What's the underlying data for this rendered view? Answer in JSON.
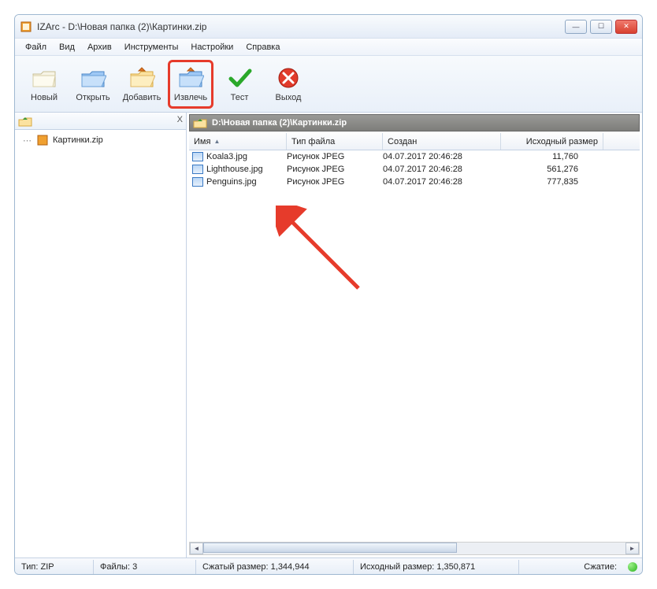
{
  "window_title": "IZArc - D:\\Новая папка (2)\\Картинки.zip",
  "menu": {
    "file": "Файл",
    "view": "Вид",
    "archive": "Архив",
    "tools": "Инструменты",
    "settings": "Настройки",
    "help": "Справка"
  },
  "toolbar": {
    "new": "Новый",
    "open": "Открыть",
    "add": "Добавить",
    "extract": "Извлечь",
    "test": "Тест",
    "exit": "Выход"
  },
  "tree": {
    "root": "Картинки.zip"
  },
  "path_display": "D:\\Новая папка (2)\\Картинки.zip",
  "columns": {
    "name": "Имя",
    "type": "Тип файла",
    "created": "Создан",
    "orig_size": "Исходный размер"
  },
  "files": [
    {
      "name": "Koala3.jpg",
      "type": "Рисунок JPEG",
      "date": "04.07.2017 20:46:28",
      "size": "11,760"
    },
    {
      "name": "Lighthouse.jpg",
      "type": "Рисунок JPEG",
      "date": "04.07.2017 20:46:28",
      "size": "561,276"
    },
    {
      "name": "Penguins.jpg",
      "type": "Рисунок JPEG",
      "date": "04.07.2017 20:46:28",
      "size": "777,835"
    }
  ],
  "status": {
    "type_lbl": "Тип:",
    "type_val": "ZIP",
    "files_lbl": "Файлы:",
    "files_val": "3",
    "packed_lbl": "Сжатый размер:",
    "packed_val": "1,344,944",
    "orig_lbl": "Исходный размер:",
    "orig_val": "1,350,871",
    "ratio_lbl": "Сжатие:"
  },
  "tab_close": "X"
}
